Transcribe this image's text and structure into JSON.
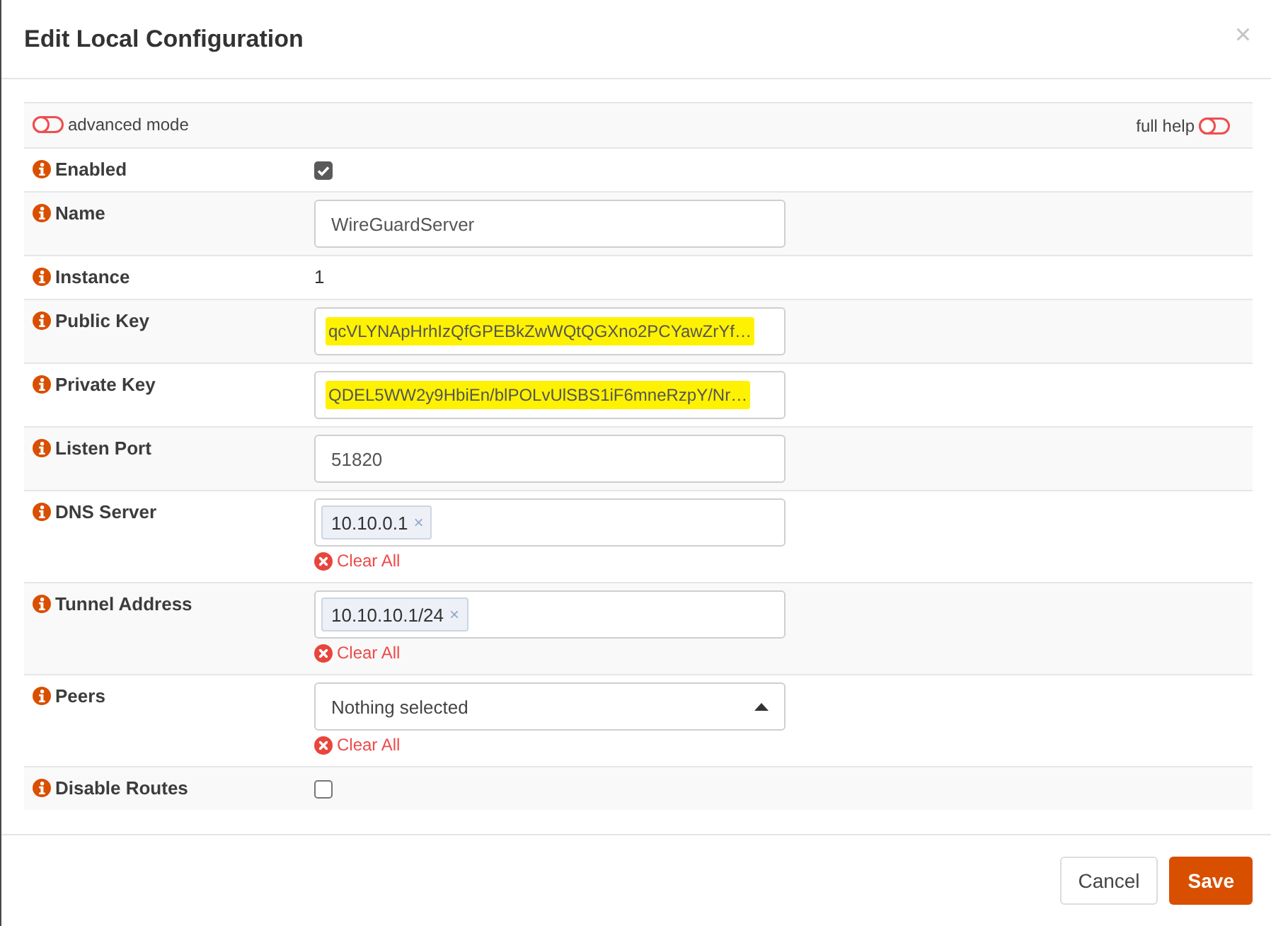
{
  "dialog": {
    "title": "Edit Local Configuration",
    "close": "×"
  },
  "mode_bar": {
    "advanced_mode": {
      "label": "advanced mode",
      "on": false
    },
    "full_help": {
      "label": "full help",
      "on": false
    }
  },
  "fields": [
    {
      "kind": "checkbox",
      "label": "Enabled",
      "checked": true
    },
    {
      "kind": "text",
      "label": "Name",
      "value": "WireGuardServer",
      "highlighted": false
    },
    {
      "kind": "static",
      "label": "Instance",
      "value": "1"
    },
    {
      "kind": "text",
      "label": "Public Key",
      "value": "qcVLYNApHrhIzQfGPEBkZwWQtQGXno2PCYawZrYf…",
      "highlighted": true
    },
    {
      "kind": "text",
      "label": "Private Key",
      "value": "QDEL5WW2y9HbiEn/blPOLvUlSBS1iF6mneRzpY/Nr…",
      "highlighted": true
    },
    {
      "kind": "text",
      "label": "Listen Port",
      "value": "51820",
      "highlighted": false
    },
    {
      "kind": "tags",
      "label": "DNS Server",
      "tags": [
        {
          "text": "10.10.0.1",
          "remove": "×"
        }
      ],
      "clear_all": "Clear All"
    },
    {
      "kind": "tags",
      "label": "Tunnel Address",
      "tags": [
        {
          "text": "10.10.10.1/24",
          "remove": "×"
        }
      ],
      "clear_all": "Clear All"
    },
    {
      "kind": "select",
      "label": "Peers",
      "placeholder": "Nothing selected",
      "clear_all": "Clear All"
    },
    {
      "kind": "checkbox",
      "label": "Disable Routes",
      "checked": false
    }
  ],
  "buttons": [
    {
      "label": "Cancel",
      "kind": "secondary"
    },
    {
      "label": "Save",
      "kind": "primary"
    }
  ]
}
